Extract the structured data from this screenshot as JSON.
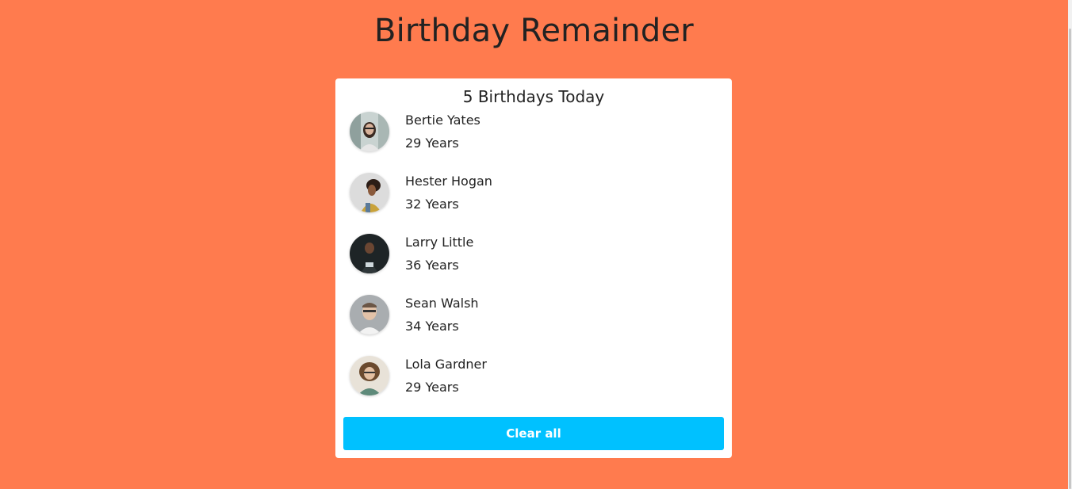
{
  "header": {
    "title": "Birthday Remainder"
  },
  "card": {
    "title": "5 Birthdays Today",
    "people": [
      {
        "name": "Bertie Yates",
        "age": "29 Years",
        "avatar_icon": "avatar-photo-icon"
      },
      {
        "name": "Hester Hogan",
        "age": "32 Years",
        "avatar_icon": "avatar-photo-icon"
      },
      {
        "name": "Larry Little",
        "age": "36 Years",
        "avatar_icon": "avatar-photo-icon"
      },
      {
        "name": "Sean Walsh",
        "age": "34 Years",
        "avatar_icon": "avatar-photo-icon"
      },
      {
        "name": "Lola Gardner",
        "age": "29 Years",
        "avatar_icon": "avatar-photo-icon"
      }
    ],
    "clear_label": "Clear all"
  },
  "colors": {
    "background": "#ff7b4e",
    "card": "#ffffff",
    "button": "#00c1ff",
    "text": "#222222"
  }
}
